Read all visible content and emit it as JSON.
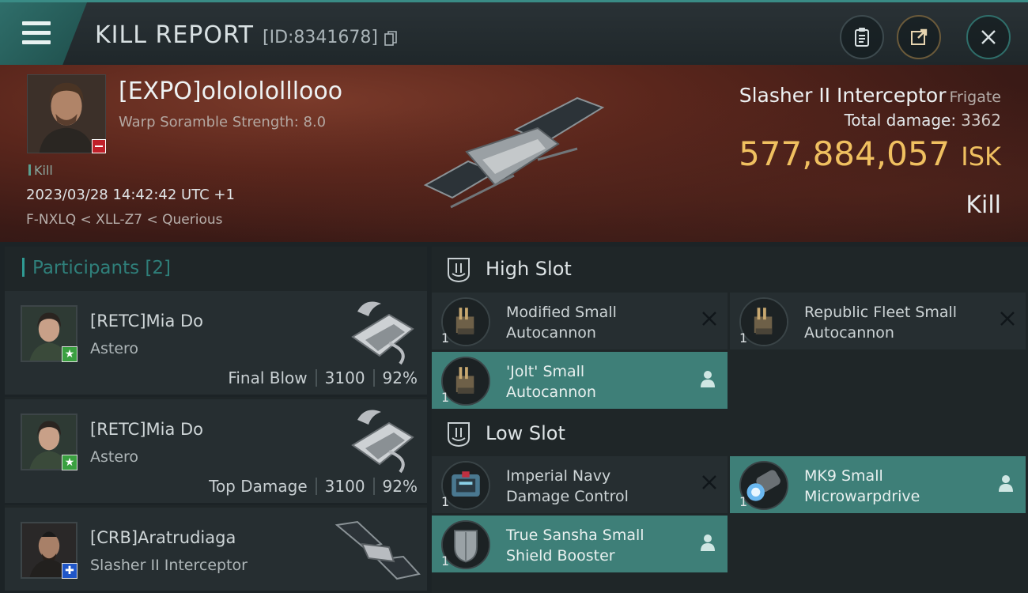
{
  "header": {
    "title": "KILL REPORT",
    "report_id": "[ID:8341678]",
    "buttons": [
      "clipboard-icon",
      "share-icon",
      "close-icon"
    ]
  },
  "victim": {
    "name": "[EXPO]ololololllooo",
    "scramble": "Warp Soramble Strength: 8.0",
    "kill_tag": "Kill",
    "timestamp": "2023/03/28 14:42:42 UTC +1",
    "location": "F-NXLQ < XLL-Z7 < Querious",
    "ship": "Slasher II Interceptor",
    "ship_class": "Frigate",
    "total_damage_label": "Total damage:",
    "total_damage": "3362",
    "isk_value": "577,884,057",
    "isk_unit": "ISK",
    "result": "Kill"
  },
  "participants": {
    "title": "Participants",
    "count": "[2]",
    "rows": [
      {
        "name": "[RETC]Mia Do",
        "ship": "Astero",
        "role": "Final Blow",
        "damage": "3100",
        "percent": "92%",
        "badge": "star"
      },
      {
        "name": "[RETC]Mia Do",
        "ship": "Astero",
        "role": "Top Damage",
        "damage": "3100",
        "percent": "92%",
        "badge": "star"
      },
      {
        "name": "[CRB]Aratrudiaga",
        "ship": "Slasher II Interceptor",
        "role": "",
        "damage": "",
        "percent": "",
        "badge": "plus"
      }
    ]
  },
  "fitting": {
    "high_slot": {
      "title": "High Slot",
      "modules": [
        {
          "name_line1": "Modified Small",
          "name_line2": "Autocannon",
          "qty": "1",
          "status": "destroyed"
        },
        {
          "name_line1": "Republic Fleet Small",
          "name_line2": "Autocannon",
          "qty": "1",
          "status": "destroyed"
        },
        {
          "name_line1": "'Jolt' Small",
          "name_line2": "Autocannon",
          "qty": "1",
          "status": "dropped"
        }
      ]
    },
    "low_slot": {
      "title": "Low Slot",
      "modules": [
        {
          "name_line1": "Imperial Navy",
          "name_line2": "Damage Control",
          "qty": "1",
          "status": "destroyed"
        },
        {
          "name_line1": "MK9 Small",
          "name_line2": "Microwarpdrive",
          "qty": "1",
          "status": "dropped"
        },
        {
          "name_line1": "True Sansha Small",
          "name_line2": "Shield Booster",
          "qty": "1",
          "status": "dropped"
        }
      ]
    }
  },
  "colors": {
    "accent": "#3e7f78",
    "isk": "#f0c060",
    "badge_green": "#3aa040",
    "badge_blue": "#2056c8",
    "badge_red": "#c0202a"
  }
}
